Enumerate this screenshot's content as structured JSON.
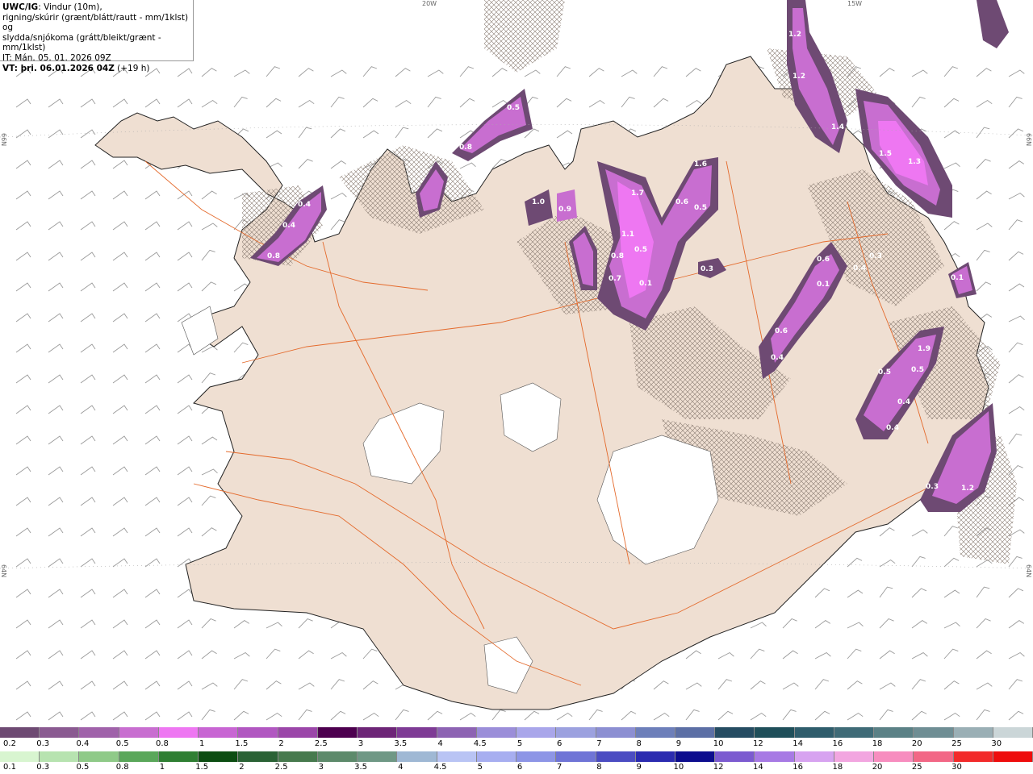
{
  "header": {
    "model": "UWC/IG",
    "line1": ": Vindur (10m),",
    "line2": "rigning/skúrir (grænt/blátt/rautt - mm/1klst) og",
    "line3": "slydda/snjókoma (grátt/bleikt/grænt - mm/1klst)",
    "it_label": "IT: Mán. 05. 01. 2026 09Z",
    "vt_label": "VT: þri. 06.01.2026 04Z",
    "vt_offset": " (+19 h)"
  },
  "graticule": {
    "lon_20": "20W",
    "lon_15": "15W",
    "lat_66_left": "66N",
    "lat_66_right": "66N",
    "lat_64_left": "64N",
    "lat_64_right": "64N"
  },
  "precip_labels": [
    "1.2",
    "1.2",
    "1.4",
    "1.5",
    "1.3",
    "0.5",
    "0.8",
    "1.6",
    "1.7",
    "0.6",
    "0.5",
    "1.1",
    "0.5",
    "0.8",
    "0.7",
    "0.1",
    "0.3",
    "0.6",
    "0.1",
    "0.4",
    "0.3",
    "0.6",
    "0.4",
    "0.8",
    "0.4",
    "0.4",
    "1.9",
    "0.5",
    "0.5",
    "0.4",
    "0.4",
    "0.3",
    "1.2",
    "0.1",
    "0.3",
    "0.9",
    "1.0"
  ],
  "legend": {
    "snow": {
      "labels": [
        "0.2",
        "0.3",
        "0.4",
        "0.5",
        "0.8",
        "1",
        "1.5",
        "2",
        "2.5",
        "3",
        "3.5",
        "4",
        "4.5",
        "5",
        "6",
        "7",
        "8",
        "9",
        "10",
        "12",
        "14",
        "16",
        "18",
        "20",
        "25",
        "30"
      ],
      "colors": [
        "#6e4a73",
        "#8a5a91",
        "#a062aa",
        "#c86ed0",
        "#ee77f2",
        "#c865d3",
        "#b157c1",
        "#9b46a9",
        "#4d004f",
        "#6d2577",
        "#7e3b95",
        "#8d63b3",
        "#9b8ed9",
        "#a9a6ea",
        "#9ca1df",
        "#8c8fd2",
        "#6d7fba",
        "#5c6fa5",
        "#254c62",
        "#1f4f5a",
        "#2f5d6c",
        "#3f6b77",
        "#5b8186",
        "#6f8e94",
        "#9aafb5",
        "#cbd6d8"
      ]
    },
    "rain": {
      "labels": [
        "0.1",
        "0.3",
        "0.5",
        "0.8",
        "1",
        "1.5",
        "2",
        "2.5",
        "3",
        "3.5",
        "4",
        "4.5",
        "5",
        "6",
        "7",
        "8",
        "9",
        "10",
        "12",
        "14",
        "16",
        "18",
        "20",
        "25",
        "30"
      ],
      "colors": [
        "#d8f5d0",
        "#b7e3b0",
        "#8fca88",
        "#5aa75a",
        "#2f7f33",
        "#0c4d12",
        "#2a6235",
        "#477a4e",
        "#5d8a6b",
        "#6f9885",
        "#9fb8d4",
        "#b9c4f4",
        "#a7aef0",
        "#8d95e6",
        "#6f74d6",
        "#4b4cc2",
        "#2b2bb0",
        "#0d0d8e",
        "#7c5bd0",
        "#a77ae4",
        "#d7a3f0",
        "#f2a6e0",
        "#f78dbf",
        "#f26786",
        "#f22a2a",
        "#ee0d0d"
      ]
    }
  }
}
